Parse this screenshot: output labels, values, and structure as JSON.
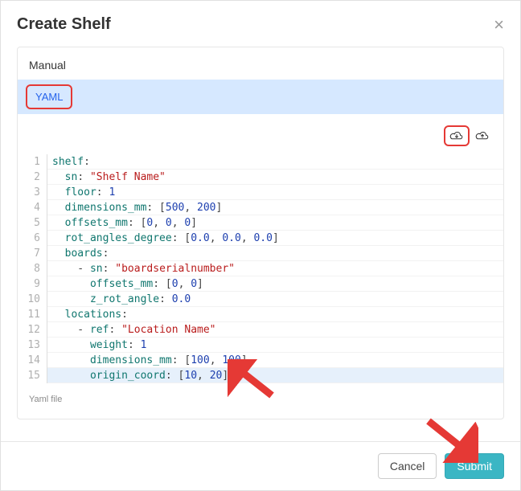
{
  "modal": {
    "title": "Create Shelf",
    "manual_label": "Manual",
    "tab_label": "YAML",
    "helper_text": "Yaml file"
  },
  "colors": {
    "highlight_border": "#e53935",
    "tab_bg": "#d6e8ff",
    "submit_bg": "#3bb6c4",
    "arrow": "#e53935"
  },
  "footer": {
    "cancel_label": "Cancel",
    "submit_label": "Submit"
  },
  "code": {
    "active_line": 15,
    "lines": [
      {
        "n": 1,
        "t": [
          {
            "c": "k",
            "v": "shelf"
          },
          {
            "c": "p",
            "v": ":"
          }
        ]
      },
      {
        "n": 2,
        "t": [
          {
            "c": "p",
            "v": "  "
          },
          {
            "c": "k",
            "v": "sn"
          },
          {
            "c": "p",
            "v": ": "
          },
          {
            "c": "s",
            "v": "\"Shelf Name\""
          }
        ]
      },
      {
        "n": 3,
        "t": [
          {
            "c": "p",
            "v": "  "
          },
          {
            "c": "k",
            "v": "floor"
          },
          {
            "c": "p",
            "v": ": "
          },
          {
            "c": "n",
            "v": "1"
          }
        ]
      },
      {
        "n": 4,
        "t": [
          {
            "c": "p",
            "v": "  "
          },
          {
            "c": "k",
            "v": "dimensions_mm"
          },
          {
            "c": "p",
            "v": ": ["
          },
          {
            "c": "n",
            "v": "500"
          },
          {
            "c": "p",
            "v": ", "
          },
          {
            "c": "n",
            "v": "200"
          },
          {
            "c": "p",
            "v": "]"
          }
        ]
      },
      {
        "n": 5,
        "t": [
          {
            "c": "p",
            "v": "  "
          },
          {
            "c": "k",
            "v": "offsets_mm"
          },
          {
            "c": "p",
            "v": ": ["
          },
          {
            "c": "n",
            "v": "0"
          },
          {
            "c": "p",
            "v": ", "
          },
          {
            "c": "n",
            "v": "0"
          },
          {
            "c": "p",
            "v": ", "
          },
          {
            "c": "n",
            "v": "0"
          },
          {
            "c": "p",
            "v": "]"
          }
        ]
      },
      {
        "n": 6,
        "t": [
          {
            "c": "p",
            "v": "  "
          },
          {
            "c": "k",
            "v": "rot_angles_degree"
          },
          {
            "c": "p",
            "v": ": ["
          },
          {
            "c": "n",
            "v": "0.0"
          },
          {
            "c": "p",
            "v": ", "
          },
          {
            "c": "n",
            "v": "0.0"
          },
          {
            "c": "p",
            "v": ", "
          },
          {
            "c": "n",
            "v": "0.0"
          },
          {
            "c": "p",
            "v": "]"
          }
        ]
      },
      {
        "n": 7,
        "t": [
          {
            "c": "p",
            "v": "  "
          },
          {
            "c": "k",
            "v": "boards"
          },
          {
            "c": "p",
            "v": ":"
          }
        ]
      },
      {
        "n": 8,
        "t": [
          {
            "c": "p",
            "v": "    - "
          },
          {
            "c": "k",
            "v": "sn"
          },
          {
            "c": "p",
            "v": ": "
          },
          {
            "c": "s",
            "v": "\"boardserialnumber\""
          }
        ]
      },
      {
        "n": 9,
        "t": [
          {
            "c": "p",
            "v": "      "
          },
          {
            "c": "k",
            "v": "offsets_mm"
          },
          {
            "c": "p",
            "v": ": ["
          },
          {
            "c": "n",
            "v": "0"
          },
          {
            "c": "p",
            "v": ", "
          },
          {
            "c": "n",
            "v": "0"
          },
          {
            "c": "p",
            "v": "]"
          }
        ]
      },
      {
        "n": 10,
        "t": [
          {
            "c": "p",
            "v": "      "
          },
          {
            "c": "k",
            "v": "z_rot_angle"
          },
          {
            "c": "p",
            "v": ": "
          },
          {
            "c": "n",
            "v": "0.0"
          }
        ]
      },
      {
        "n": 11,
        "t": [
          {
            "c": "p",
            "v": "  "
          },
          {
            "c": "k",
            "v": "locations"
          },
          {
            "c": "p",
            "v": ":"
          }
        ]
      },
      {
        "n": 12,
        "t": [
          {
            "c": "p",
            "v": "    - "
          },
          {
            "c": "k",
            "v": "ref"
          },
          {
            "c": "p",
            "v": ": "
          },
          {
            "c": "s",
            "v": "\"Location Name\""
          }
        ]
      },
      {
        "n": 13,
        "t": [
          {
            "c": "p",
            "v": "      "
          },
          {
            "c": "k",
            "v": "weight"
          },
          {
            "c": "p",
            "v": ": "
          },
          {
            "c": "n",
            "v": "1"
          }
        ]
      },
      {
        "n": 14,
        "t": [
          {
            "c": "p",
            "v": "      "
          },
          {
            "c": "k",
            "v": "dimensions_mm"
          },
          {
            "c": "p",
            "v": ": ["
          },
          {
            "c": "n",
            "v": "100"
          },
          {
            "c": "p",
            "v": ", "
          },
          {
            "c": "n",
            "v": "100"
          },
          {
            "c": "p",
            "v": "]"
          }
        ]
      },
      {
        "n": 15,
        "t": [
          {
            "c": "p",
            "v": "      "
          },
          {
            "c": "k",
            "v": "origin_coord"
          },
          {
            "c": "p",
            "v": ": ["
          },
          {
            "c": "n",
            "v": "10"
          },
          {
            "c": "p",
            "v": ", "
          },
          {
            "c": "n",
            "v": "20"
          },
          {
            "c": "p",
            "v": "]"
          }
        ]
      }
    ]
  }
}
